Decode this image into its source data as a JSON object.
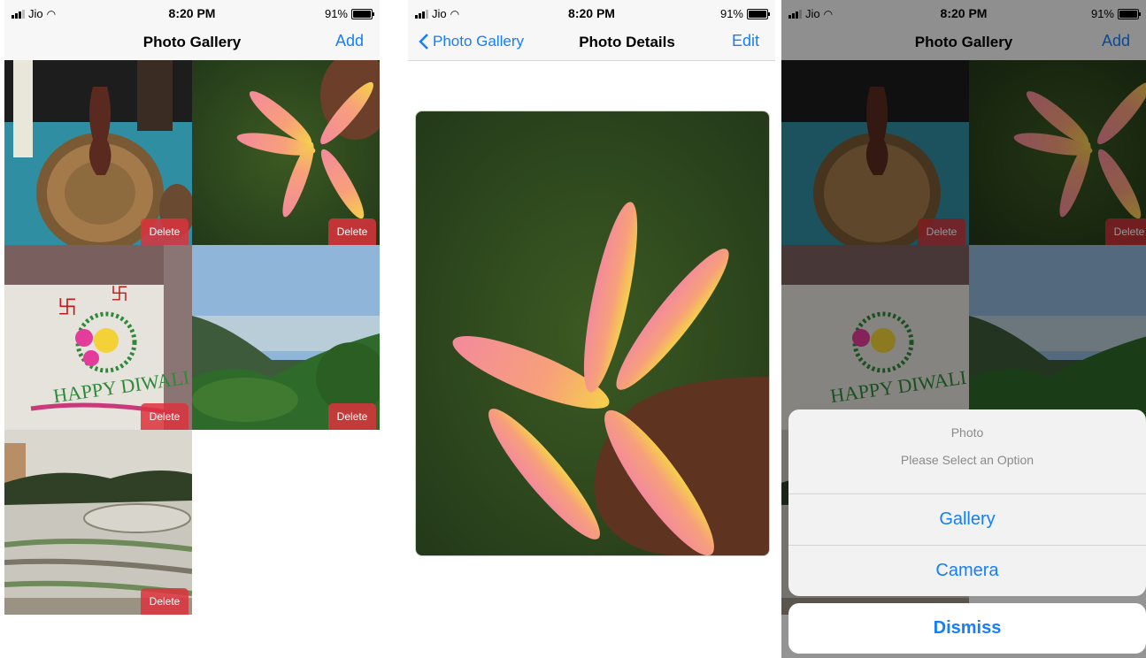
{
  "status": {
    "carrier": "Jio",
    "time": "8:20 PM",
    "battery": "91%"
  },
  "gallery": {
    "title": "Photo Gallery",
    "add_label": "Add",
    "tiles": [
      {
        "subject": "table-with-vase",
        "delete_label": "Delete"
      },
      {
        "subject": "plumeria-flower",
        "delete_label": "Delete"
      },
      {
        "subject": "diwali-rangoli",
        "delete_label": "Delete"
      },
      {
        "subject": "mountain-landscape",
        "delete_label": "Delete"
      },
      {
        "subject": "amphitheater",
        "delete_label": "Delete"
      }
    ]
  },
  "details": {
    "back_label": "Photo Gallery",
    "title": "Photo Details",
    "edit_label": "Edit"
  },
  "action_sheet": {
    "title": "Photo",
    "message": "Please Select an Option",
    "options": [
      "Gallery",
      "Camera"
    ],
    "dismiss_label": "Dismiss"
  },
  "colors": {
    "tint": "#147efb",
    "delete": "#dc323c"
  }
}
